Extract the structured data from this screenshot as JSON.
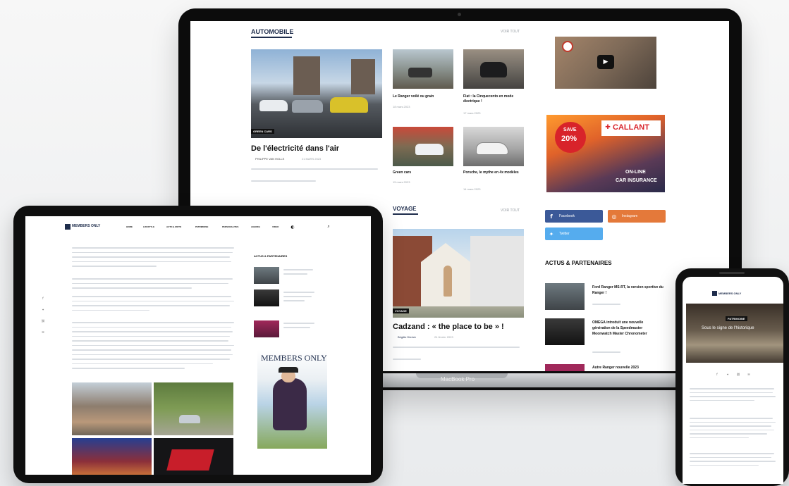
{
  "laptop": {
    "brand_label": "MacBook Pro",
    "section_automobile": "AUTOMOBILE",
    "section_voyage": "VOYAGE",
    "view_all": "VOIR TOUT",
    "featured": {
      "category": "GREEN CARS",
      "title": "De l'électricité dans l'air",
      "author": "PHILIPPE VAN HOLLE",
      "date": "21 MARS 2023"
    },
    "articles": [
      {
        "title": "Le Ranger voilé ou grain",
        "date": "18 mars 2023"
      },
      {
        "title": "Fiat : la Cinquecento en mode électrique !",
        "date": "17 mars 2023"
      },
      {
        "title": "Green cars",
        "date": "15 mars 2023"
      },
      {
        "title": "Porsche, le mythe en 4x modèles",
        "date": "14 mars 2023"
      }
    ],
    "voyage": {
      "category": "VOYAGE",
      "title": "Cadzand : « the place to be » !",
      "author": "Brigitte Dierick",
      "date": "24 février 2023"
    },
    "social": {
      "facebook": "Facebook",
      "instagram": "Instagram",
      "twitter": "Twitter"
    },
    "ad_callant": {
      "brand": "CALLANT",
      "badge_top": "SAVE",
      "badge_pct": "20%",
      "tag1": "ON-LINE",
      "tag2": "CAR INSURANCE"
    },
    "actus_heading": "ACTUS & PARTENAIRES",
    "actus": [
      {
        "title": "Ford Ranger MS-RT, la version sportive du Ranger !"
      },
      {
        "title": "OMEGA introduit une nouvelle génération de la Speedmaster Moonwatch Master Chronometer"
      },
      {
        "title": "Autre Ranger nouvelle 2023"
      }
    ]
  },
  "tablet": {
    "site_name": "MEMBERS ONLY",
    "nav": [
      "HOME",
      "LIFESTYLE",
      "AUTO & MOTO",
      "PATRIMOINE",
      "PERSONALITES",
      "AGENDA",
      "VIDEO"
    ],
    "actus_heading": "ACTUS & PARTENAIRES",
    "magazine_title": "MEMBERS ONLY"
  },
  "phone": {
    "site_name": "MEMBERS ONLY",
    "hero_tag": "PATRIMOINE",
    "hero_title": "Sous le signe de l'historique"
  },
  "colors": {
    "facebook": "#3b5998",
    "instagram": "#e4793a",
    "twitter": "#55acee",
    "ad_red": "#d8232a",
    "navy": "#1f2d4c"
  }
}
